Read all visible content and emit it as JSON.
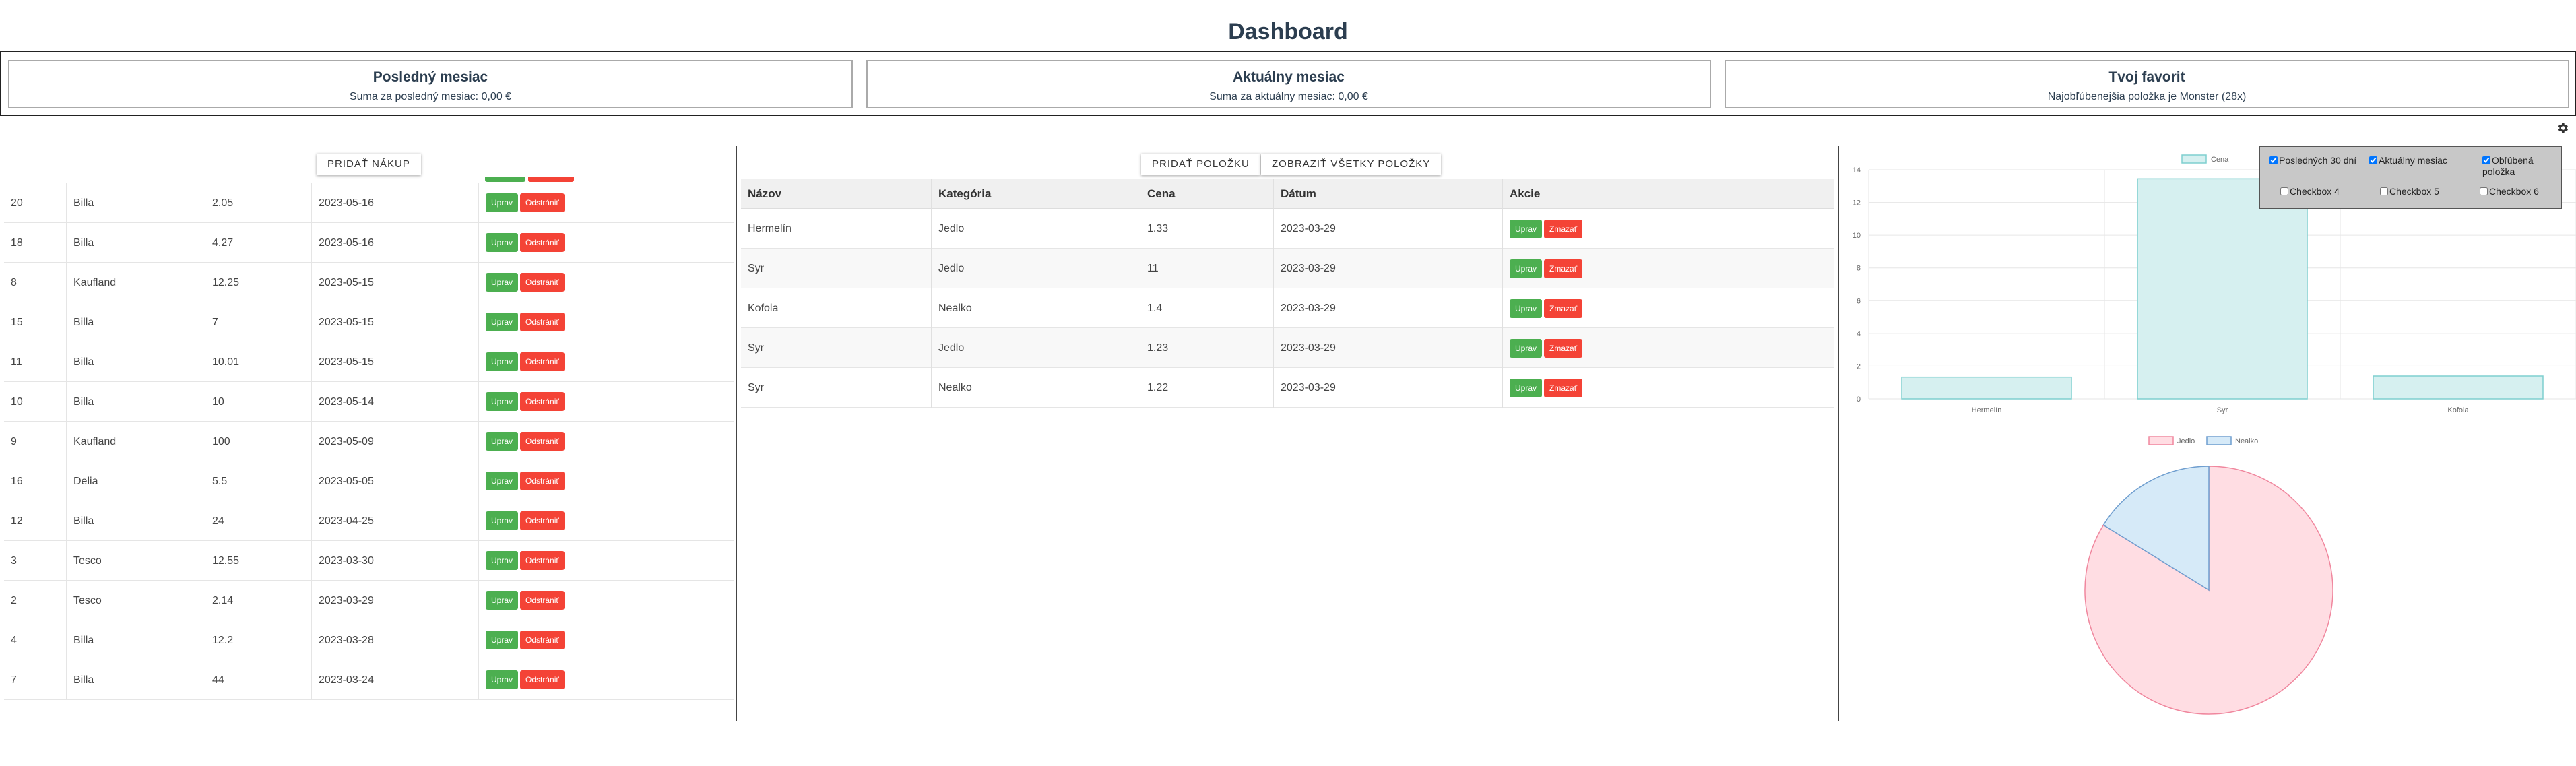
{
  "title": "Dashboard",
  "cards": [
    {
      "title": "Posledný mesiac",
      "text": "Suma za posledný mesiac: 0,00 €"
    },
    {
      "title": "Aktuálny mesiac",
      "text": "Suma za aktuálny mesiac: 0,00 €"
    },
    {
      "title": "Tvoj favorit",
      "text": "Najobľúbenejšia položka je Monster (28x)"
    }
  ],
  "left_panel": {
    "add_button": "PRIDAŤ NÁKUP",
    "edit_label": "Uprav",
    "delete_label": "Odstrániť",
    "rows": [
      {
        "id": "20",
        "store": "Billa",
        "amount": "2.05",
        "date": "2023-05-16"
      },
      {
        "id": "18",
        "store": "Billa",
        "amount": "4.27",
        "date": "2023-05-16"
      },
      {
        "id": "8",
        "store": "Kaufland",
        "amount": "12.25",
        "date": "2023-05-15"
      },
      {
        "id": "15",
        "store": "Billa",
        "amount": "7",
        "date": "2023-05-15"
      },
      {
        "id": "11",
        "store": "Billa",
        "amount": "10.01",
        "date": "2023-05-15"
      },
      {
        "id": "10",
        "store": "Billa",
        "amount": "10",
        "date": "2023-05-14"
      },
      {
        "id": "9",
        "store": "Kaufland",
        "amount": "100",
        "date": "2023-05-09"
      },
      {
        "id": "16",
        "store": "Delia",
        "amount": "5.5",
        "date": "2023-05-05"
      },
      {
        "id": "12",
        "store": "Billa",
        "amount": "24",
        "date": "2023-04-25"
      },
      {
        "id": "3",
        "store": "Tesco",
        "amount": "12.55",
        "date": "2023-03-30"
      },
      {
        "id": "2",
        "store": "Tesco",
        "amount": "2.14",
        "date": "2023-03-29"
      },
      {
        "id": "4",
        "store": "Billa",
        "amount": "12.2",
        "date": "2023-03-28"
      },
      {
        "id": "7",
        "store": "Billa",
        "amount": "44",
        "date": "2023-03-24"
      }
    ]
  },
  "middle_panel": {
    "add_button": "PRIDAŤ POLOŽKU",
    "show_all_button": "ZOBRAZIŤ VŠETKY POLOŽKY",
    "headers": [
      "Názov",
      "Kategória",
      "Cena",
      "Dátum",
      "Akcie"
    ],
    "edit_label": "Uprav",
    "delete_label": "Zmazať",
    "rows": [
      {
        "name": "Hermelín",
        "category": "Jedlo",
        "price": "1.33",
        "date": "2023-03-29"
      },
      {
        "name": "Syr",
        "category": "Jedlo",
        "price": "11",
        "date": "2023-03-29"
      },
      {
        "name": "Kofola",
        "category": "Nealko",
        "price": "1.4",
        "date": "2023-03-29"
      },
      {
        "name": "Syr",
        "category": "Jedlo",
        "price": "1.23",
        "date": "2023-03-29"
      },
      {
        "name": "Syr",
        "category": "Nealko",
        "price": "1.22",
        "date": "2023-03-29"
      }
    ]
  },
  "settings": {
    "checkboxes": [
      {
        "label": "Posledných 30 dní",
        "checked": true
      },
      {
        "label": "Aktuálny mesiac",
        "checked": true
      },
      {
        "label": "Obľúbená položka",
        "checked": true
      },
      {
        "label": "Checkbox 4",
        "checked": false
      },
      {
        "label": "Checkbox 5",
        "checked": false
      },
      {
        "label": "Checkbox 6",
        "checked": false
      }
    ]
  },
  "icons": {
    "settings": "gear-icon"
  },
  "colors": {
    "green": "#4caf50",
    "red": "#f44336",
    "bar_fill": "#d6f0f0",
    "bar_stroke": "#7fcfcf",
    "pie_jedlo": "#ffdde3",
    "pie_jedlo_stroke": "#f0879e",
    "pie_nealko": "#d6eaf8",
    "pie_nealko_stroke": "#6f9ecf"
  },
  "chart_data": [
    {
      "type": "bar",
      "categories": [
        "Hermelín",
        "Syr",
        "Kofola"
      ],
      "series": [
        {
          "name": "Cena",
          "values": [
            1.33,
            13.45,
            1.4
          ]
        }
      ],
      "ylim": [
        0,
        14
      ],
      "yticks": [
        "0",
        "2",
        "4",
        "6",
        "8",
        "10",
        "12",
        "14"
      ],
      "legend": "top"
    },
    {
      "type": "pie",
      "labels": [
        "Jedlo",
        "Nealko"
      ],
      "values": [
        13.56,
        2.62
      ],
      "legend": "top"
    }
  ]
}
